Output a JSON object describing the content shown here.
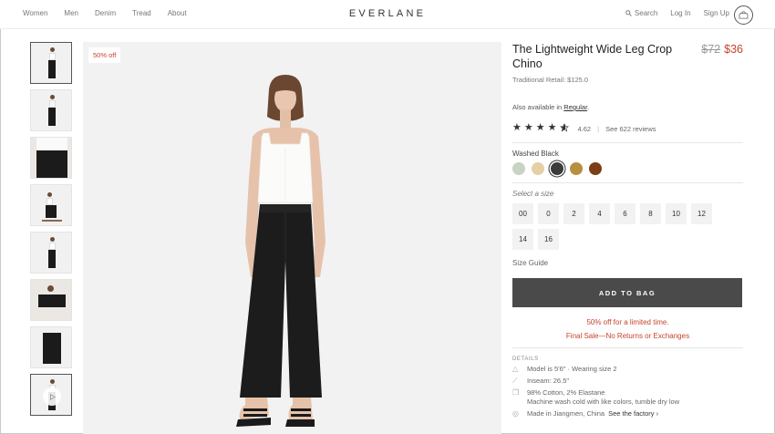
{
  "header": {
    "nav": [
      "Women",
      "Men",
      "Denim",
      "Tread",
      "About"
    ],
    "logo": "EVERLANE",
    "search_label": "Search",
    "login_label": "Log In",
    "signup_label": "Sign Up"
  },
  "gallery": {
    "badge": "50% off"
  },
  "product": {
    "title": "The Lightweight Wide Leg Crop Chino",
    "old_price": "$72",
    "new_price": "$36",
    "retail": "Traditional Retail: $125.0",
    "also_prefix": "Also available in",
    "also_link": "Regular",
    "also_suffix": ".",
    "rating_value": "4.62",
    "rating_sep": "|",
    "reviews_link": "See 622 reviews",
    "color_name": "Washed Black",
    "swatch_colors": [
      "#c9d3c4",
      "#e6cfa5",
      "#3b3b3b",
      "#b88f3e",
      "#7a3f15"
    ],
    "size_prompt": "Select a size",
    "sizes": [
      "00",
      "0",
      "2",
      "4",
      "6",
      "8",
      "10",
      "12",
      "14",
      "16"
    ],
    "size_guide": "Size Guide",
    "add_to_bag": "ADD TO BAG",
    "promo1": "50% off for a limited time.",
    "promo2": "Final Sale—No Returns or Exchanges",
    "details_heading": "DETAILS",
    "details": {
      "model": "Model is 5'6\" · Wearing size 2",
      "inseam": "Inseam: 26.5\"",
      "material1": "98% Cotton, 2% Elastane",
      "material2": "Machine wash cold with like colors, tumble dry low",
      "made_in": "Made in Jiangmen, China",
      "see_factory": "See the factory ›"
    }
  },
  "colors": {
    "accent_red": "#c7432b",
    "button_dark": "#4a4a4a"
  }
}
